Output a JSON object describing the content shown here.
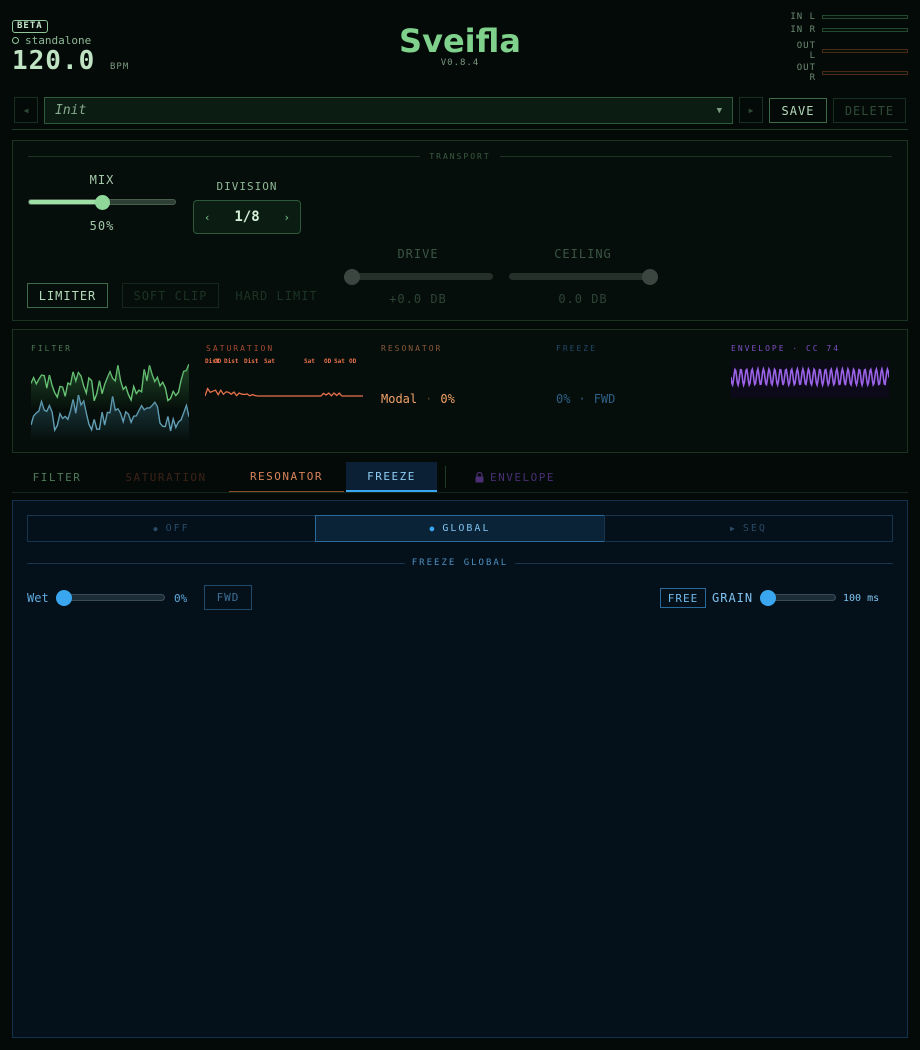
{
  "header": {
    "badge": "BETA",
    "mode": "standalone",
    "bpm": "120.0",
    "bpm_label": "BPM",
    "title": "Sveifla",
    "version": "V0.8.4",
    "meters": [
      {
        "label": "IN L",
        "level": 0
      },
      {
        "label": "IN R",
        "level": 0
      },
      {
        "label": "OUT L",
        "level": 0
      },
      {
        "label": "OUT R",
        "level": 0
      }
    ]
  },
  "preset": {
    "prev_icon": "◀",
    "next_icon": "▶",
    "name": "Init",
    "caret": "▼",
    "save": "SAVE",
    "delete": "DELETE"
  },
  "transport": {
    "label": "TRANSPORT",
    "mix_label": "MIX",
    "mix_value": "50%",
    "mix_level": 0.5,
    "division_label": "DIVISION",
    "division_prev": "‹",
    "division_value": "1/8",
    "division_next": "›",
    "modes": [
      "LIMITER",
      "SOFT CLIP",
      "HARD LIMIT"
    ],
    "drive_label": "DRIVE",
    "drive_value": "+0.0 DB",
    "ceiling_label": "CEILING",
    "ceiling_value": "0.0 DB"
  },
  "modules": {
    "filter": {
      "label": "FILTER",
      "color": "#6fce7c",
      "color2": "#6aa8c0"
    },
    "saturation": {
      "label": "SATURATION",
      "color": "#e8704d",
      "tags": [
        "Dist",
        "OD",
        "Dist",
        "Dist",
        "Sat",
        "Sat",
        "OD",
        "Sat",
        "OD"
      ]
    },
    "resonator": {
      "label": "RESONATOR",
      "mode": "Modal",
      "sep": "·",
      "value": "0%",
      "color": "#f2a36a"
    },
    "freeze": {
      "label": "FREEZE",
      "value": "0%",
      "sep": "·",
      "dir": "FWD",
      "color": "#2e5f87"
    },
    "envelope": {
      "label": "ENVELOPE · CC 74",
      "color": "#9b63e8"
    }
  },
  "tabs": [
    {
      "label": "FILTER",
      "color": "#4f7a58"
    },
    {
      "label": "SATURATION",
      "color": "#3e2218"
    },
    {
      "label": "RESONATOR",
      "color": "#d98359"
    },
    {
      "label": "FREEZE",
      "color": "#8fcdf5"
    },
    {
      "label": "ENVELOPE",
      "color": "#4a2f73",
      "locked": true
    }
  ],
  "freeze_panel": {
    "modes": [
      {
        "icon": "●",
        "label": "OFF"
      },
      {
        "icon": "●",
        "label": "GLOBAL"
      },
      {
        "icon": "▶",
        "label": "SEQ"
      }
    ],
    "section_title": "FREEZE GLOBAL",
    "wet_label": "Wet",
    "wet_value": "0%",
    "wet_level": 0,
    "direction": "FWD",
    "free_label": "FREE",
    "grain_label": "GRAIN",
    "grain_value": "100 ms",
    "grain_level": 0.08
  },
  "colors": {
    "accent_green": "#7fd18b",
    "accent_blue": "#3aa6f0",
    "background": "#030a08"
  }
}
